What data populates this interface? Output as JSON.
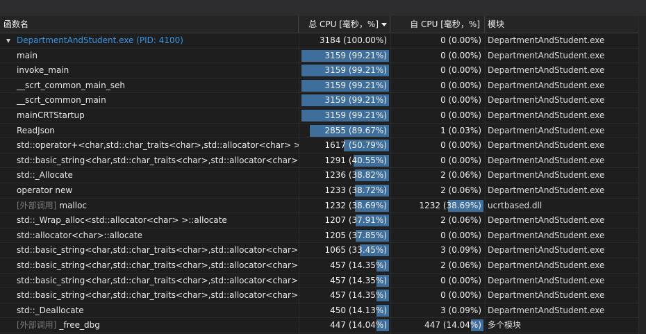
{
  "header": {
    "name": "函数名",
    "total_cpu": "总 CPU [毫秒，%]",
    "self_cpu": "自 CPU [毫秒，%]",
    "module": "模块"
  },
  "rows": [
    {
      "ext": "",
      "name": "DepartmentAndStudent.exe (PID: 4100)",
      "root": true,
      "total": "3184 (100.00%)",
      "total_pct": 0,
      "self": "0 (0.00%)",
      "self_pct": 0,
      "module": "DepartmentAndStudent.exe"
    },
    {
      "ext": "",
      "name": "main",
      "root": false,
      "total": "3159 (99.21%)",
      "total_pct": 99.21,
      "self": "0 (0.00%)",
      "self_pct": 0,
      "module": "DepartmentAndStudent.exe"
    },
    {
      "ext": "",
      "name": "invoke_main",
      "root": false,
      "total": "3159 (99.21%)",
      "total_pct": 99.21,
      "self": "0 (0.00%)",
      "self_pct": 0,
      "module": "DepartmentAndStudent.exe"
    },
    {
      "ext": "",
      "name": "__scrt_common_main_seh",
      "root": false,
      "total": "3159 (99.21%)",
      "total_pct": 99.21,
      "self": "0 (0.00%)",
      "self_pct": 0,
      "module": "DepartmentAndStudent.exe"
    },
    {
      "ext": "",
      "name": "__scrt_common_main",
      "root": false,
      "total": "3159 (99.21%)",
      "total_pct": 99.21,
      "self": "0 (0.00%)",
      "self_pct": 0,
      "module": "DepartmentAndStudent.exe"
    },
    {
      "ext": "",
      "name": "mainCRTStartup",
      "root": false,
      "total": "3159 (99.21%)",
      "total_pct": 99.21,
      "self": "0 (0.00%)",
      "self_pct": 0,
      "module": "DepartmentAndStudent.exe"
    },
    {
      "ext": "",
      "name": "ReadJson",
      "root": false,
      "total": "2855 (89.67%)",
      "total_pct": 89.67,
      "self": "1 (0.03%)",
      "self_pct": 0.03,
      "module": "DepartmentAndStudent.exe"
    },
    {
      "ext": "",
      "name": "std::operator+<char,std::char_traits<char>,std::allocator<char> >",
      "root": false,
      "total": "1617 (50.79%)",
      "total_pct": 50.79,
      "self": "0 (0.00%)",
      "self_pct": 0,
      "module": "DepartmentAndStudent.exe"
    },
    {
      "ext": "",
      "name": "std::basic_string<char,std::char_traits<char>,std::allocator<char> >::...",
      "root": false,
      "total": "1291 (40.55%)",
      "total_pct": 40.55,
      "self": "0 (0.00%)",
      "self_pct": 0,
      "module": "DepartmentAndStudent.exe"
    },
    {
      "ext": "",
      "name": "std::_Allocate",
      "root": false,
      "total": "1236 (38.82%)",
      "total_pct": 38.82,
      "self": "2 (0.06%)",
      "self_pct": 0.06,
      "module": "DepartmentAndStudent.exe"
    },
    {
      "ext": "",
      "name": "operator new",
      "root": false,
      "total": "1233 (38.72%)",
      "total_pct": 38.72,
      "self": "2 (0.06%)",
      "self_pct": 0.06,
      "module": "DepartmentAndStudent.exe"
    },
    {
      "ext": "[外部调用]",
      "name": "malloc",
      "root": false,
      "total": "1232 (38.69%)",
      "total_pct": 38.69,
      "self": "1232 (38.69%)",
      "self_pct": 38.69,
      "module": "ucrtbased.dll"
    },
    {
      "ext": "",
      "name": "std::_Wrap_alloc<std::allocator<char> >::allocate",
      "root": false,
      "total": "1207 (37.91%)",
      "total_pct": 37.91,
      "self": "2 (0.06%)",
      "self_pct": 0.06,
      "module": "DepartmentAndStudent.exe"
    },
    {
      "ext": "",
      "name": "std::allocator<char>::allocate",
      "root": false,
      "total": "1205 (37.85%)",
      "total_pct": 37.85,
      "self": "0 (0.00%)",
      "self_pct": 0,
      "module": "DepartmentAndStudent.exe"
    },
    {
      "ext": "",
      "name": "std::basic_string<char,std::char_traits<char>,std::allocator<char> >::...",
      "root": false,
      "total": "1065 (33.45%)",
      "total_pct": 33.45,
      "self": "3 (0.09%)",
      "self_pct": 0.09,
      "module": "DepartmentAndStudent.exe"
    },
    {
      "ext": "",
      "name": "std::basic_string<char,std::char_traits<char>,std::allocator<char> >::...",
      "root": false,
      "total": "457 (14.35%)",
      "total_pct": 14.35,
      "self": "2 (0.06%)",
      "self_pct": 0.06,
      "module": "DepartmentAndStudent.exe"
    },
    {
      "ext": "",
      "name": "std::basic_string<char,std::char_traits<char>,std::allocator<char> >::...",
      "root": false,
      "total": "457 (14.35%)",
      "total_pct": 14.35,
      "self": "0 (0.00%)",
      "self_pct": 0,
      "module": "DepartmentAndStudent.exe"
    },
    {
      "ext": "",
      "name": "std::basic_string<char,std::char_traits<char>,std::allocator<char> >::...",
      "root": false,
      "total": "457 (14.35%)",
      "total_pct": 14.35,
      "self": "0 (0.00%)",
      "self_pct": 0,
      "module": "DepartmentAndStudent.exe"
    },
    {
      "ext": "",
      "name": "std::_Deallocate",
      "root": false,
      "total": "450 (14.13%)",
      "total_pct": 14.13,
      "self": "3 (0.09%)",
      "self_pct": 0.09,
      "module": "DepartmentAndStudent.exe"
    },
    {
      "ext": "[外部调用]",
      "name": "_free_dbg",
      "root": false,
      "total": "447 (14.04%)",
      "total_pct": 14.04,
      "self": "447 (14.04%)",
      "self_pct": 14.04,
      "module": "多个模块"
    }
  ],
  "colors": {
    "bar": "#3e6e9c",
    "root_link": "#3794e5",
    "background": "#1e1e1e"
  }
}
